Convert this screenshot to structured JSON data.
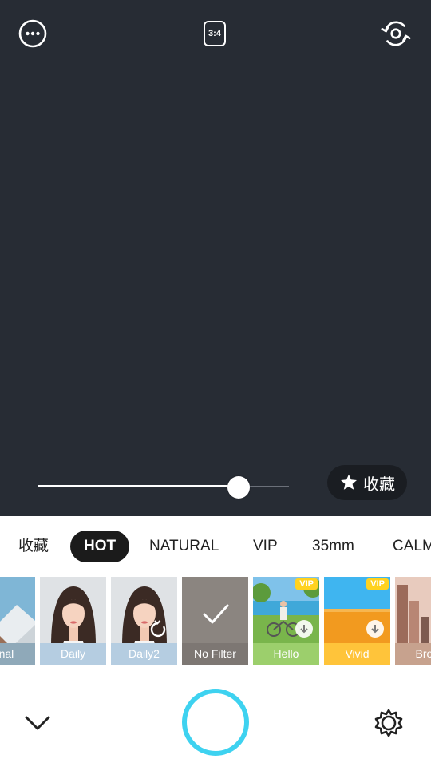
{
  "top": {
    "more_icon": "more-dots-icon",
    "ratio_label": "3:4",
    "switch_icon": "camera-switch-icon"
  },
  "slider": {
    "value": 0.8
  },
  "favorite_button": {
    "icon": "star-icon",
    "label": "收藏"
  },
  "tabs": [
    {
      "label": "收藏",
      "active": false
    },
    {
      "label": "HOT",
      "active": true
    },
    {
      "label": "NATURAL",
      "active": false
    },
    {
      "label": "VIP",
      "active": false
    },
    {
      "label": "35mm",
      "active": false
    },
    {
      "label": "CALM",
      "active": false
    }
  ],
  "filters": [
    {
      "label": "ginal",
      "caption_color": "#8fa9b9"
    },
    {
      "label": "Daily",
      "caption_color": "#b5cde1"
    },
    {
      "label": "Daily2",
      "caption_color": "#b5cde1"
    },
    {
      "label": "No Filter",
      "caption_color": "#7d7773"
    },
    {
      "label": "Hello",
      "caption_color": "#9ccf6c",
      "vip": "VIP"
    },
    {
      "label": "Vivid",
      "caption_color": "#ffc43a",
      "vip": "VIP"
    },
    {
      "label": "Brow",
      "caption_color": "#c7a28e"
    }
  ],
  "bottom": {
    "collapse_icon": "chevron-down-icon",
    "settings_icon": "gear-icon"
  },
  "colors": {
    "accent": "#3ed2f0",
    "viewport": "#272c34"
  }
}
